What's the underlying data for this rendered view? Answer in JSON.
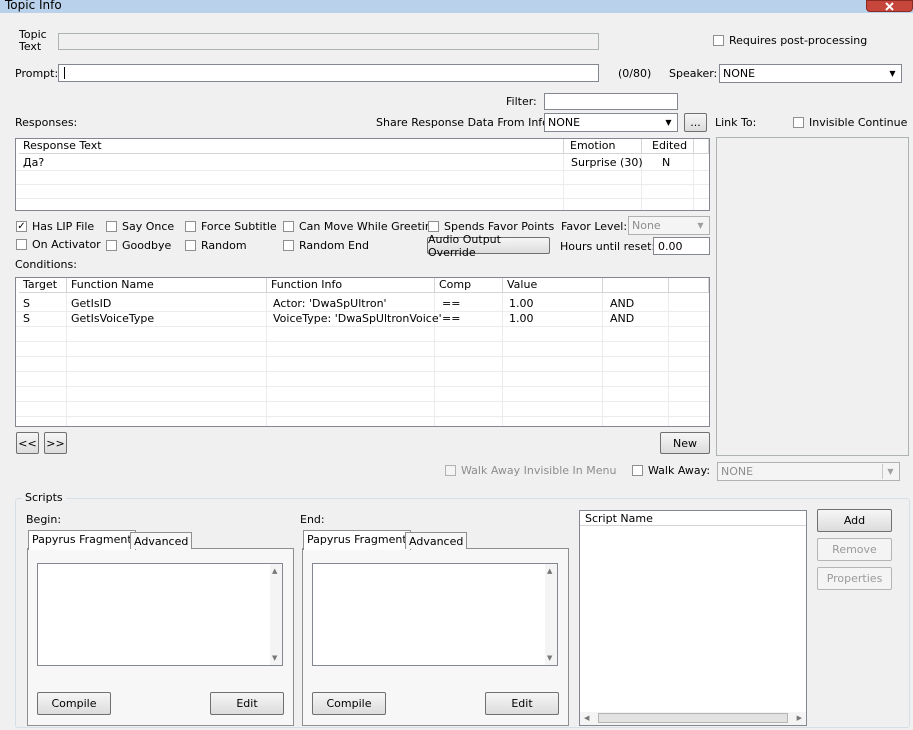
{
  "window": {
    "title": "Topic Info"
  },
  "topic": {
    "label": "Topic\nText",
    "value": ""
  },
  "requires_post_processing": {
    "label": "Requires post-processing",
    "checked": false
  },
  "prompt": {
    "label": "Prompt:",
    "value": "",
    "counter": "(0/80)"
  },
  "speaker": {
    "label": "Speaker:",
    "value": "NONE"
  },
  "filter": {
    "label": "Filter:",
    "value": ""
  },
  "responses": {
    "label": "Responses:",
    "share_label": "Share Response Data From Info:",
    "share_value": "NONE",
    "ellipsis": "...",
    "columns": [
      "Response Text",
      "Emotion",
      "Edited"
    ],
    "rows": [
      [
        "Да?",
        "Surprise (30)",
        "N"
      ]
    ]
  },
  "link_to": {
    "label": "Link To:"
  },
  "invisible_continue": {
    "label": "Invisible Continue",
    "checked": false
  },
  "options": {
    "has_lip_file": {
      "label": "Has LIP File",
      "checked": true
    },
    "say_once": {
      "label": "Say Once",
      "checked": false
    },
    "force_subtitle": {
      "label": "Force Subtitle",
      "checked": false
    },
    "can_move_while_greeting": {
      "label": "Can Move While Greeting",
      "checked": false
    },
    "spends_favor_points": {
      "label": "Spends Favor Points",
      "checked": false
    },
    "on_activator": {
      "label": "On Activator",
      "checked": false
    },
    "goodbye": {
      "label": "Goodbye",
      "checked": false
    },
    "random": {
      "label": "Random",
      "checked": false
    },
    "random_end": {
      "label": "Random End",
      "checked": false
    }
  },
  "favor_level": {
    "label": "Favor Level:",
    "value": "None"
  },
  "audio_output_override": {
    "label": "Audio Output Override"
  },
  "hours_until_reset": {
    "label": "Hours until reset:",
    "value": "0.00"
  },
  "conditions": {
    "label": "Conditions:",
    "columns": [
      "Target",
      "Function Name",
      "Function Info",
      "Comp",
      "Value",
      ""
    ],
    "rows": [
      [
        "S",
        "GetIsID",
        "Actor: 'DwaSpUltron'",
        "==",
        "1.00",
        "AND"
      ],
      [
        "S",
        "GetIsVoiceType",
        "VoiceType: 'DwaSpUltronVoice'",
        "==",
        "1.00",
        "AND"
      ]
    ],
    "prev": "<<",
    "next": ">>",
    "new": "New"
  },
  "walk_away_invisible": {
    "label": "Walk Away Invisible In Menu",
    "checked": false
  },
  "walk_away": {
    "label": "Walk Away:",
    "checked": false,
    "value": "NONE"
  },
  "scripts": {
    "label": "Scripts",
    "begin": {
      "label": "Begin:",
      "tabs": [
        "Papyrus Fragment",
        "Advanced"
      ],
      "compile": "Compile",
      "edit": "Edit"
    },
    "end": {
      "label": "End:",
      "tabs": [
        "Papyrus Fragment",
        "Advanced"
      ],
      "compile": "Compile",
      "edit": "Edit"
    },
    "list_header": "Script Name",
    "add": "Add",
    "remove": "Remove",
    "properties": "Properties"
  },
  "icons": {
    "check": "check-icon",
    "dropdown": "dropdown-arrow-icon",
    "close": "close-icon"
  }
}
